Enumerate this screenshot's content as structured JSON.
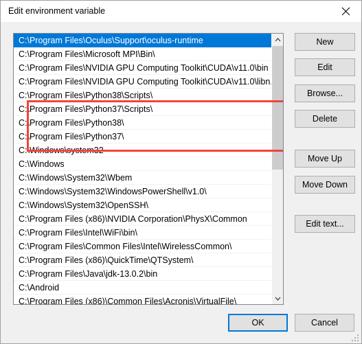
{
  "window": {
    "title": "Edit environment variable",
    "close_icon": "close-icon"
  },
  "list": {
    "selected_index": 0,
    "selection_color": "#0078d7",
    "rows": [
      "C:\\Program Files\\Oculus\\Support\\oculus-runtime",
      "C:\\Program Files\\Microsoft MPI\\Bin\\",
      "C:\\Program Files\\NVIDIA GPU Computing Toolkit\\CUDA\\v11.0\\bin",
      "C:\\Program Files\\NVIDIA GPU Computing Toolkit\\CUDA\\v11.0\\libn...",
      "C:\\Program Files\\Python38\\Scripts\\",
      "C:\\Program Files\\Python37\\Scripts\\",
      "C:\\Program Files\\Python38\\",
      "C:\\Program Files\\Python37\\",
      "C:\\Windows\\system32",
      "C:\\Windows",
      "C:\\Windows\\System32\\Wbem",
      "C:\\Windows\\System32\\WindowsPowerShell\\v1.0\\",
      "C:\\Windows\\System32\\OpenSSH\\",
      "C:\\Program Files (x86)\\NVIDIA Corporation\\PhysX\\Common",
      "C:\\Program Files\\Intel\\WiFi\\bin\\",
      "C:\\Program Files\\Common Files\\Intel\\WirelessCommon\\",
      "C:\\Program Files (x86)\\QuickTime\\QTSystem\\",
      "C:\\Program Files\\Java\\jdk-13.0.2\\bin",
      "C:\\Android",
      "C:\\Program Files (x86)\\Common Files\\Acronis\\VirtualFile\\",
      ""
    ]
  },
  "annotation": {
    "color": "#f4433c",
    "highlighted_rows": [
      "C:\\Program Files\\Python38\\Scripts\\",
      "C:\\Program Files\\Python37\\Scripts\\",
      "C:\\Program Files\\Python38\\",
      "C:\\Program Files\\Python37\\"
    ]
  },
  "scrollbar": {
    "up_arrow_icon": "chevron-up-icon",
    "down_arrow_icon": "chevron-down-icon"
  },
  "side_buttons": {
    "new": "New",
    "edit": "Edit",
    "browse": "Browse...",
    "delete": "Delete",
    "move_up": "Move Up",
    "move_down": "Move Down",
    "edit_text": "Edit text..."
  },
  "footer": {
    "ok": "OK",
    "cancel": "Cancel"
  }
}
